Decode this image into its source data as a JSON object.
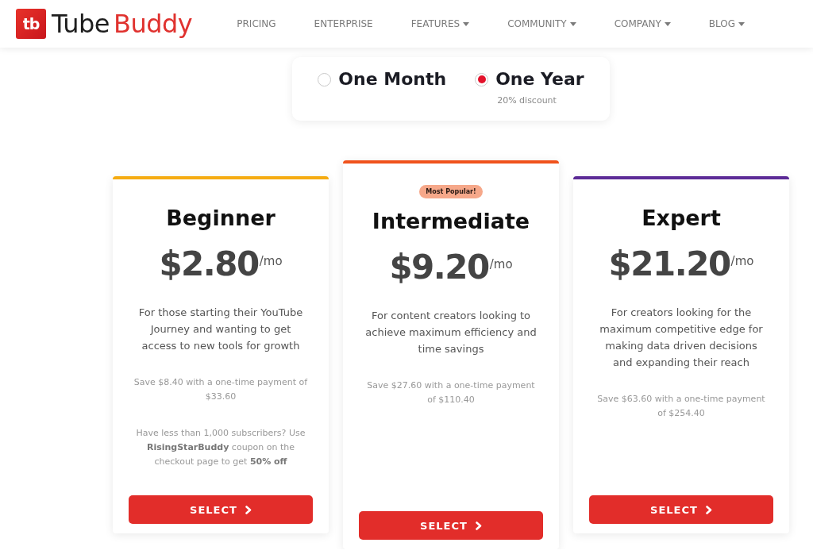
{
  "header": {
    "logo": {
      "mark": "tb",
      "name_first": "Tube",
      "name_second": "Buddy"
    },
    "nav": [
      {
        "label": "PRICING",
        "dropdown": false
      },
      {
        "label": "ENTERPRISE",
        "dropdown": false
      },
      {
        "label": "FEATURES",
        "dropdown": true
      },
      {
        "label": "COMMUNITY",
        "dropdown": true
      },
      {
        "label": "COMPANY",
        "dropdown": true
      },
      {
        "label": "BLOG",
        "dropdown": true
      }
    ]
  },
  "billing": [
    {
      "label": "One Month",
      "selected": false
    },
    {
      "label": "One Year",
      "selected": true,
      "note": "20% discount"
    }
  ],
  "plans": [
    {
      "name": "Beginner",
      "color": "#f5ab11",
      "highlighted": false,
      "price": "$2.80",
      "period": "/mo",
      "description": "For those starting their YouTube Journey and wanting to get access to new tools for growth",
      "savings": "Save $8.40 with a one-time payment of $33.60",
      "note": "Have less than 1,000 subscribers? Use **RisingStarBuddy** coupon on the checkout page to get **50% off**",
      "button": "SELECT"
    },
    {
      "name": "Intermediate",
      "badge": "Most Popular!",
      "color": "#f0521c",
      "highlighted": true,
      "price": "$9.20",
      "period": "/mo",
      "description": "For content creators looking to achieve maximum efficiency and time savings",
      "savings": "Save $27.60 with a one-time payment of $110.40",
      "button": "SELECT"
    },
    {
      "name": "Expert",
      "color": "#5b2a96",
      "highlighted": false,
      "price": "$21.20",
      "period": "/mo",
      "description": "For creators looking for the maximum competitive edge for making data driven decisions and expanding their reach",
      "savings": "Save $63.60 with a one-time payment of $254.40",
      "button": "SELECT"
    }
  ]
}
